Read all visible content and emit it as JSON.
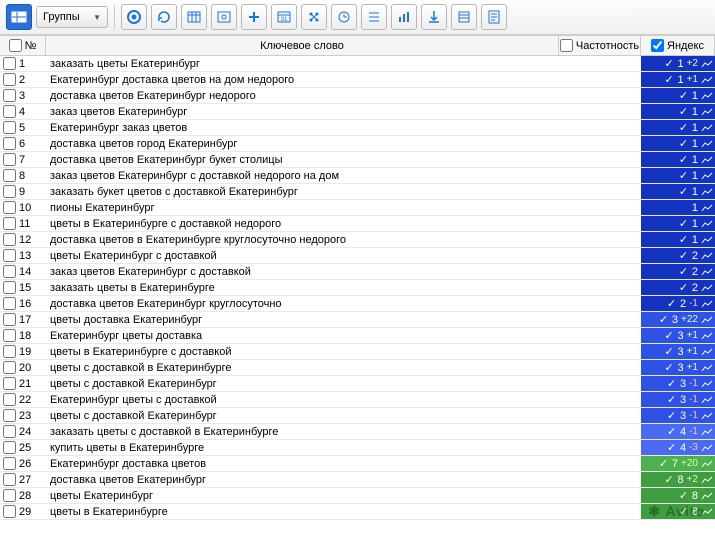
{
  "toolbar": {
    "dropdown_label": "Группы"
  },
  "header": {
    "num": "№",
    "keyword": "Ключевое слово",
    "frequency": "Частотность",
    "yandex": "Яндекс"
  },
  "watermark": "Avito",
  "rows": [
    {
      "n": 1,
      "k": "заказать цветы Екатеринбург",
      "val": "1",
      "d": "+2",
      "cls": "dblue"
    },
    {
      "n": 2,
      "k": "Екатеринбург доставка цветов на дом недорого",
      "val": "1",
      "d": "+1",
      "cls": "dblue"
    },
    {
      "n": 3,
      "k": "доставка цветов Екатеринбург недорого",
      "val": "1",
      "d": "",
      "cls": "dblue"
    },
    {
      "n": 4,
      "k": "заказ цветов Екатеринбург",
      "val": "1",
      "d": "",
      "cls": "dblue"
    },
    {
      "n": 5,
      "k": "Екатеринбург заказ цветов",
      "val": "1",
      "d": "",
      "cls": "dblue"
    },
    {
      "n": 6,
      "k": "доставка цветов город Екатеринбург",
      "val": "1",
      "d": "",
      "cls": "dblue"
    },
    {
      "n": 7,
      "k": "доставка цветов Екатеринбург букет столицы",
      "val": "1",
      "d": "",
      "cls": "dblue"
    },
    {
      "n": 8,
      "k": "заказ цветов Екатеринбург с доставкой недорого на дом",
      "val": "1",
      "d": "",
      "cls": "dblue"
    },
    {
      "n": 9,
      "k": "заказать букет цветов с доставкой Екатеринбург",
      "val": "1",
      "d": "",
      "cls": "dblue"
    },
    {
      "n": 10,
      "k": "пионы Екатеринбург",
      "val": "1",
      "d": "",
      "cls": "dblue",
      "nocheck": true
    },
    {
      "n": 11,
      "k": "цветы в Екатеринбурге с доставкой недорого",
      "val": "1",
      "d": "",
      "cls": "dblue"
    },
    {
      "n": 12,
      "k": "доставка цветов в Екатеринбурге круглосуточно недорого",
      "val": "1",
      "d": "",
      "cls": "dblue"
    },
    {
      "n": 13,
      "k": "цветы Екатеринбург с доставкой",
      "val": "2",
      "d": "",
      "cls": "dblue"
    },
    {
      "n": 14,
      "k": "заказ цветов Екатеринбург с доставкой",
      "val": "2",
      "d": "",
      "cls": "dblue"
    },
    {
      "n": 15,
      "k": "заказать цветы в Екатеринбурге",
      "val": "2",
      "d": "",
      "cls": "dblue"
    },
    {
      "n": 16,
      "k": "доставка цветов Екатеринбург круглосуточно",
      "val": "2",
      "d": "-1",
      "cls": "dblue"
    },
    {
      "n": 17,
      "k": "цветы доставка Екатеринбург",
      "val": "3",
      "d": "+22",
      "cls": "blue"
    },
    {
      "n": 18,
      "k": "Екатеринбург цветы доставка",
      "val": "3",
      "d": "+1",
      "cls": "blue"
    },
    {
      "n": 19,
      "k": "цветы в Екатеринбурге с доставкой",
      "val": "3",
      "d": "+1",
      "cls": "blue"
    },
    {
      "n": 20,
      "k": "цветы с доставкой в Екатеринбурге",
      "val": "3",
      "d": "+1",
      "cls": "blue"
    },
    {
      "n": 21,
      "k": "цветы с доставкой Екатеринбург",
      "val": "3",
      "d": "-1",
      "cls": "blue"
    },
    {
      "n": 22,
      "k": "Екатеринбург цветы с доставкой",
      "val": "3",
      "d": "-1",
      "cls": "blue"
    },
    {
      "n": 23,
      "k": "цветы с доставкой Екатеринбург",
      "val": "3",
      "d": "-1",
      "cls": "blue"
    },
    {
      "n": 24,
      "k": "заказать цветы с доставкой в Екатеринбурге",
      "val": "4",
      "d": "-1",
      "cls": "ltblue"
    },
    {
      "n": 25,
      "k": "купить цветы в Екатеринбурге",
      "val": "4",
      "d": "-3",
      "cls": "ltblue"
    },
    {
      "n": 26,
      "k": "Екатеринбург доставка цветов",
      "val": "7",
      "d": "+20",
      "cls": "green"
    },
    {
      "n": 27,
      "k": "доставка цветов Екатеринбург",
      "val": "8",
      "d": "+2",
      "cls": "dgreen"
    },
    {
      "n": 28,
      "k": "цветы Екатеринбург",
      "val": "8",
      "d": "",
      "cls": "dgreen"
    },
    {
      "n": 29,
      "k": "цветы в Екатеринбурге",
      "val": "8",
      "d": "",
      "cls": "dgreen"
    }
  ]
}
